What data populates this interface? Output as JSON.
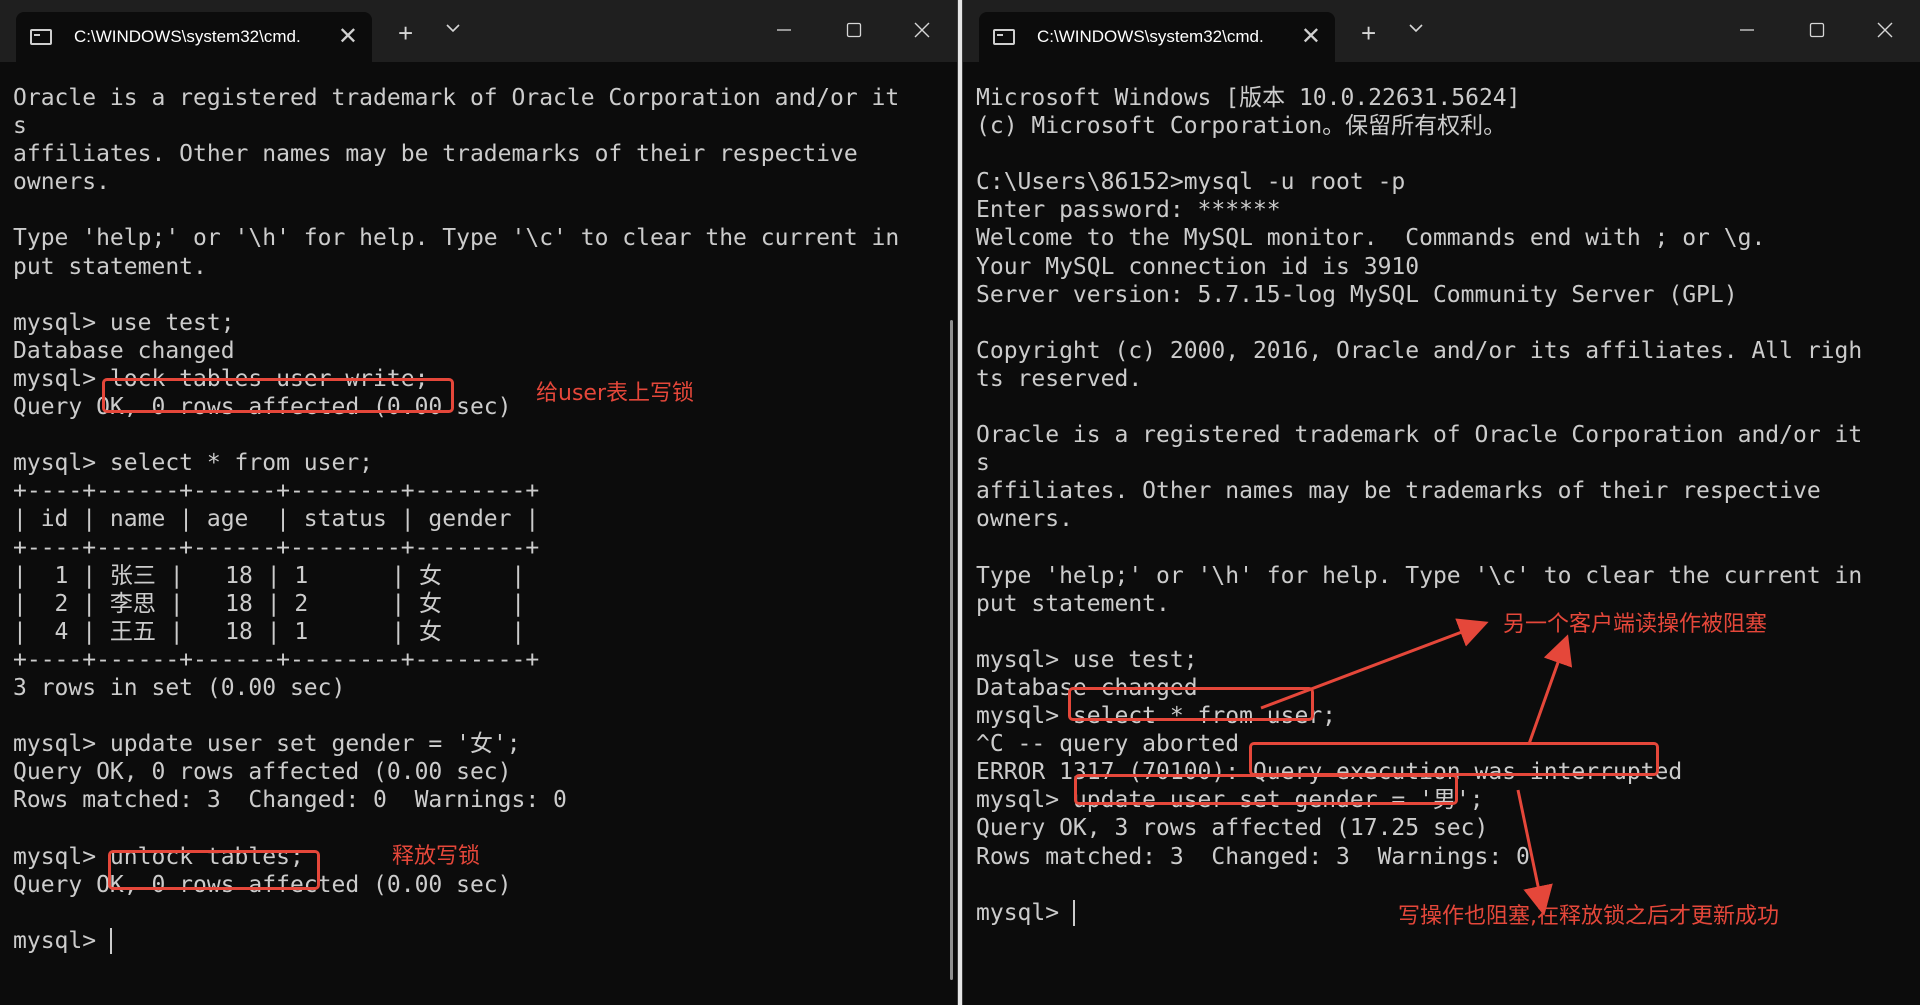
{
  "left_window": {
    "tab_title": "C:\\WINDOWS\\system32\\cmd.",
    "lines": [
      "Oracle is a registered trademark of Oracle Corporation and/or it",
      "s",
      "affiliates. Other names may be trademarks of their respective",
      "owners.",
      "",
      "Type 'help;' or '\\h' for help. Type '\\c' to clear the current in",
      "put statement.",
      "",
      "mysql> use test;",
      "Database changed",
      "mysql> lock tables user write;",
      "Query OK, 0 rows affected (0.00 sec)",
      "",
      "mysql> select * from user;",
      "+----+------+------+--------+--------+",
      "| id | name | age  | status | gender |",
      "+----+------+------+--------+--------+",
      "|  1 | 张三 |   18 | 1      | 女     |",
      "|  2 | 李思 |   18 | 2      | 女     |",
      "|  4 | 王五 |   18 | 1      | 女     |",
      "+----+------+------+--------+--------+",
      "3 rows in set (0.00 sec)",
      "",
      "mysql> update user set gender = '女';",
      "Query OK, 0 rows affected (0.00 sec)",
      "Rows matched: 3  Changed: 0  Warnings: 0",
      "",
      "mysql> unlock tables;",
      "Query OK, 0 rows affected (0.00 sec)",
      "",
      "mysql> "
    ],
    "annotations": {
      "lock_note": "给user表上写锁",
      "unlock_note": "释放写锁"
    }
  },
  "right_window": {
    "tab_title": "C:\\WINDOWS\\system32\\cmd.",
    "lines": [
      "Microsoft Windows [版本 10.0.22631.5624]",
      "(c) Microsoft Corporation。保留所有权利。",
      "",
      "C:\\Users\\86152>mysql -u root -p",
      "Enter password: ******",
      "Welcome to the MySQL monitor.  Commands end with ; or \\g.",
      "Your MySQL connection id is 3910",
      "Server version: 5.7.15-log MySQL Community Server (GPL)",
      "",
      "Copyright (c) 2000, 2016, Oracle and/or its affiliates. All righ",
      "ts reserved.",
      "",
      "Oracle is a registered trademark of Oracle Corporation and/or it",
      "s",
      "affiliates. Other names may be trademarks of their respective",
      "owners.",
      "",
      "Type 'help;' or '\\h' for help. Type '\\c' to clear the current in",
      "put statement.",
      "",
      "mysql> use test;",
      "Database changed",
      "mysql> select * from user;",
      "^C -- query aborted",
      "ERROR 1317 (70100): Query execution was interrupted",
      "mysql> update user set gender = '男';",
      "Query OK, 3 rows affected (17.25 sec)",
      "Rows matched: 3  Changed: 3  Warnings: 0",
      "",
      "mysql> "
    ],
    "annotations": {
      "read_blocked_note": "另一个客户端读操作被阻塞",
      "write_blocked_note": "写操作也阻塞,在释放锁之后才更新成功"
    }
  },
  "colors": {
    "terminal_bg": "#0c0c0c",
    "terminal_text": "#cccccc",
    "annotation": "#e5473a"
  },
  "icons": [
    "console-icon",
    "close-icon",
    "plus-icon",
    "chevron-down-icon",
    "minimize-icon",
    "maximize-icon",
    "window-close-icon"
  ]
}
